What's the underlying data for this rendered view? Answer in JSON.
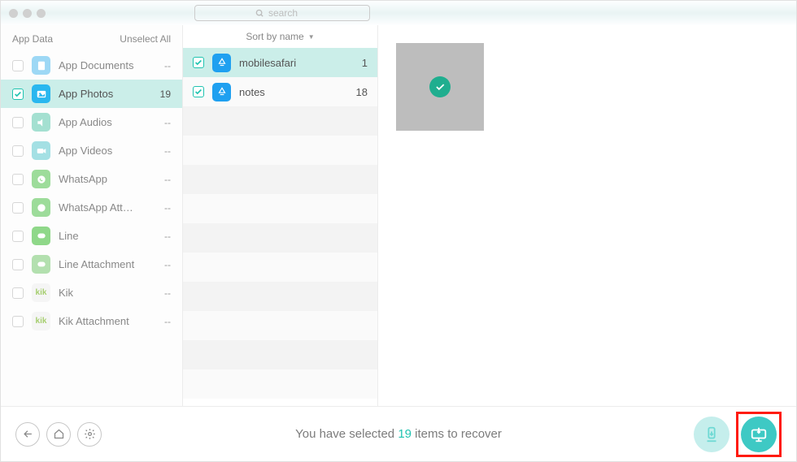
{
  "search": {
    "placeholder": "search"
  },
  "sidebar": {
    "header": "App Data",
    "unselect": "Unselect All",
    "items": [
      {
        "label": "App Documents",
        "count": "--",
        "checked": false,
        "icon": "doc",
        "color": "#66c0e8"
      },
      {
        "label": "App Photos",
        "count": "19",
        "checked": true,
        "selected": true,
        "icon": "photo",
        "color": "#29b7ef"
      },
      {
        "label": "App Audios",
        "count": "--",
        "checked": false,
        "icon": "audio",
        "color": "#8edbc2"
      },
      {
        "label": "App Videos",
        "count": "--",
        "checked": false,
        "icon": "video",
        "color": "#8edbc2"
      },
      {
        "label": "WhatsApp",
        "count": "--",
        "checked": false,
        "icon": "wa",
        "color": "#7ed17a"
      },
      {
        "label": "WhatsApp Att…",
        "count": "--",
        "checked": false,
        "icon": "wa",
        "color": "#7ed17a"
      },
      {
        "label": "Line",
        "count": "--",
        "checked": false,
        "icon": "line",
        "color": "#64cf5b"
      },
      {
        "label": "Line Attachment",
        "count": "--",
        "checked": false,
        "icon": "line",
        "color": "#92d28c"
      },
      {
        "label": "Kik",
        "count": "--",
        "checked": false,
        "icon": "kik",
        "color": "#a6ce6f"
      },
      {
        "label": "Kik Attachment",
        "count": "--",
        "checked": false,
        "icon": "kik",
        "color": "#a6ce6f"
      }
    ]
  },
  "sort": {
    "label": "Sort by name"
  },
  "list": [
    {
      "label": "mobilesafari",
      "count": "1",
      "checked": true,
      "selected": true
    },
    {
      "label": "notes",
      "count": "18",
      "checked": true,
      "selected": false
    }
  ],
  "footer": {
    "status_pre": "You have selected ",
    "status_num": "19",
    "status_post": " items to recover"
  }
}
